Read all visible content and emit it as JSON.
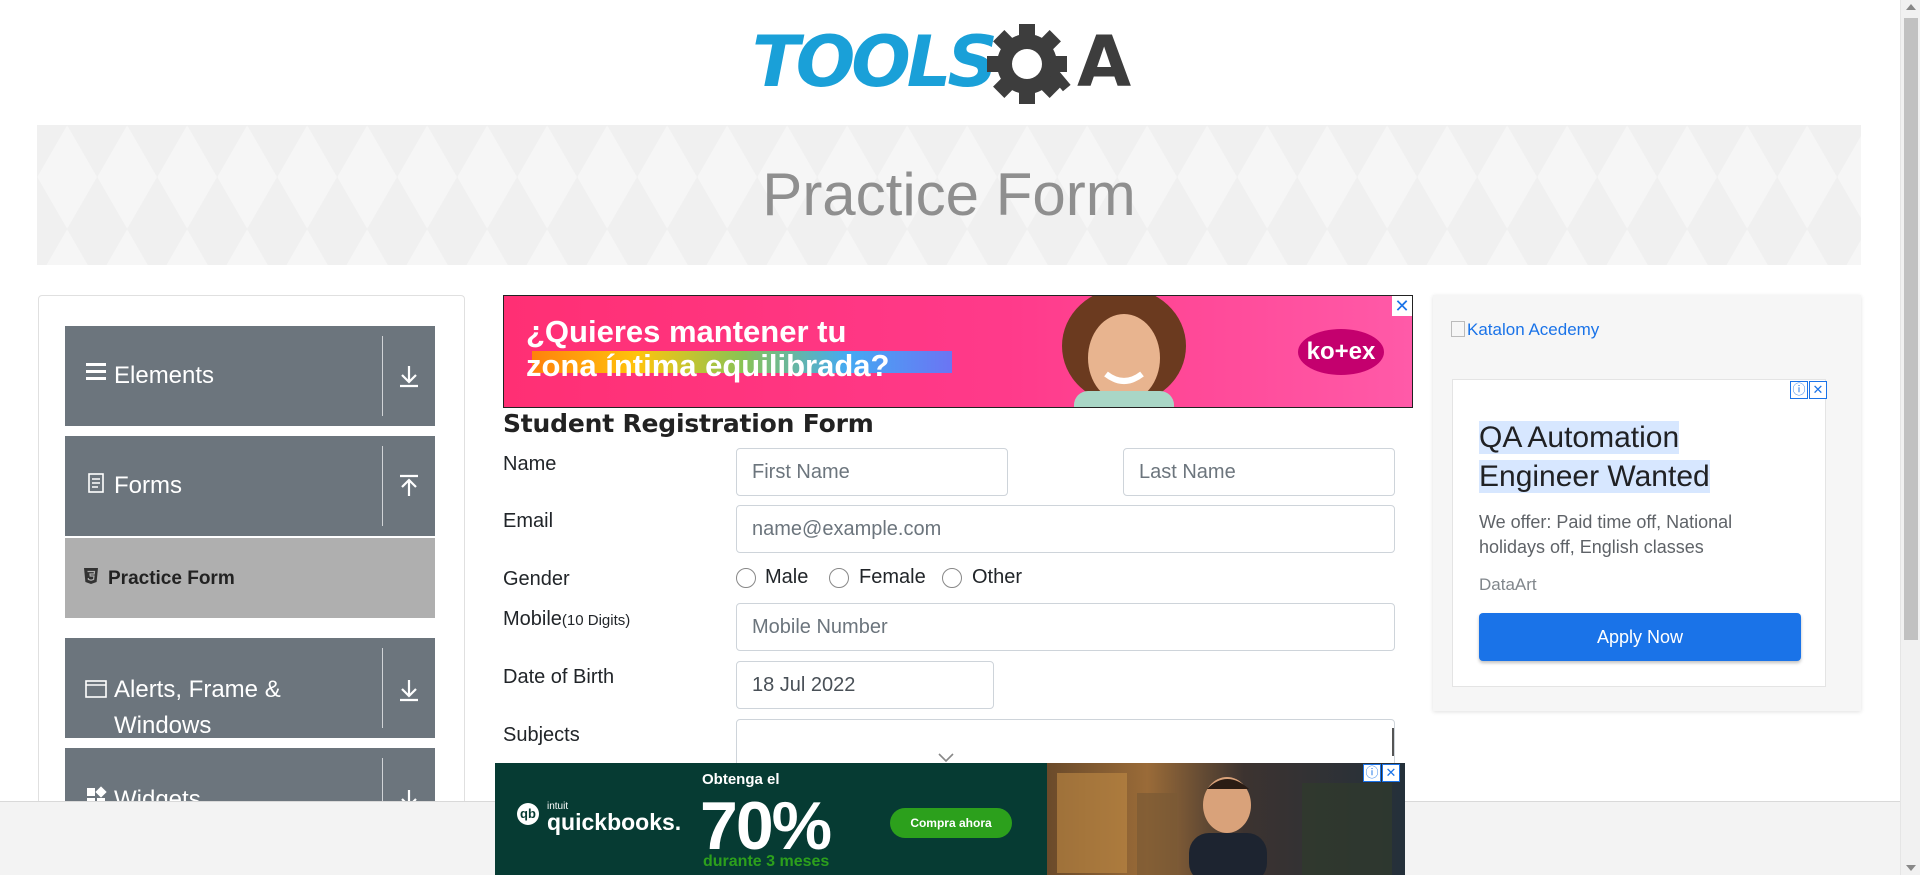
{
  "header": {
    "logo_text": "TOOLSQA",
    "logo_colors": {
      "tools": "#1aa0d8",
      "qa": "#3d3d3d"
    },
    "page_title": "Practice Form"
  },
  "sidebar": {
    "groups": [
      {
        "label": "Elements",
        "icon": "hamburger-icon",
        "arrow": "download-arrow-icon"
      },
      {
        "label": "Forms",
        "icon": "document-icon",
        "arrow": "upload-arrow-icon"
      },
      {
        "label": "Alerts, Frame &",
        "label_line2": "Windows",
        "icon": "window-icon",
        "arrow": "download-arrow-icon"
      },
      {
        "label": "Widgets",
        "icon": "widgets-icon",
        "arrow": "download-arrow-icon"
      }
    ],
    "active_item": {
      "label": "Practice Form",
      "icon": "html5-icon"
    },
    "colors": {
      "group_bg": "#6c757d",
      "active_bg": "#afafaf"
    }
  },
  "top_ad": {
    "line1": "¿Quieres mantener tu",
    "line2": "zona íntima equilibrada?",
    "brand": "ko+ex",
    "close": "✕"
  },
  "form": {
    "heading": "Student Registration Form",
    "name_label": "Name",
    "first_name_placeholder": "First Name",
    "last_name_placeholder": "Last Name",
    "email_label": "Email",
    "email_placeholder": "name@example.com",
    "gender_label": "Gender",
    "gender_options": [
      "Male",
      "Female",
      "Other"
    ],
    "mobile_label": "Mobile",
    "mobile_hint": "(10 Digits)",
    "mobile_placeholder": "Mobile Number",
    "dob_label": "Date of Birth",
    "dob_value": "18 Jul 2022",
    "subjects_label": "Subjects"
  },
  "right_sidebar": {
    "katalon_alt": "Katalon Acedemy",
    "job_ad": {
      "title": "QA Automation Engineer Wanted",
      "title_line1": "QA Automation",
      "title_line2": "Engineer Wanted",
      "description": "We offer: Paid time off, National holidays off, English classes",
      "company": "DataArt",
      "button": "Apply Now"
    }
  },
  "bottom_ad": {
    "intuit": "intuit",
    "brand": "quickbooks.",
    "headline": "Obtenga el",
    "percent": "70%",
    "sub": "durante 3 meses",
    "cta": "Compra ahora"
  }
}
